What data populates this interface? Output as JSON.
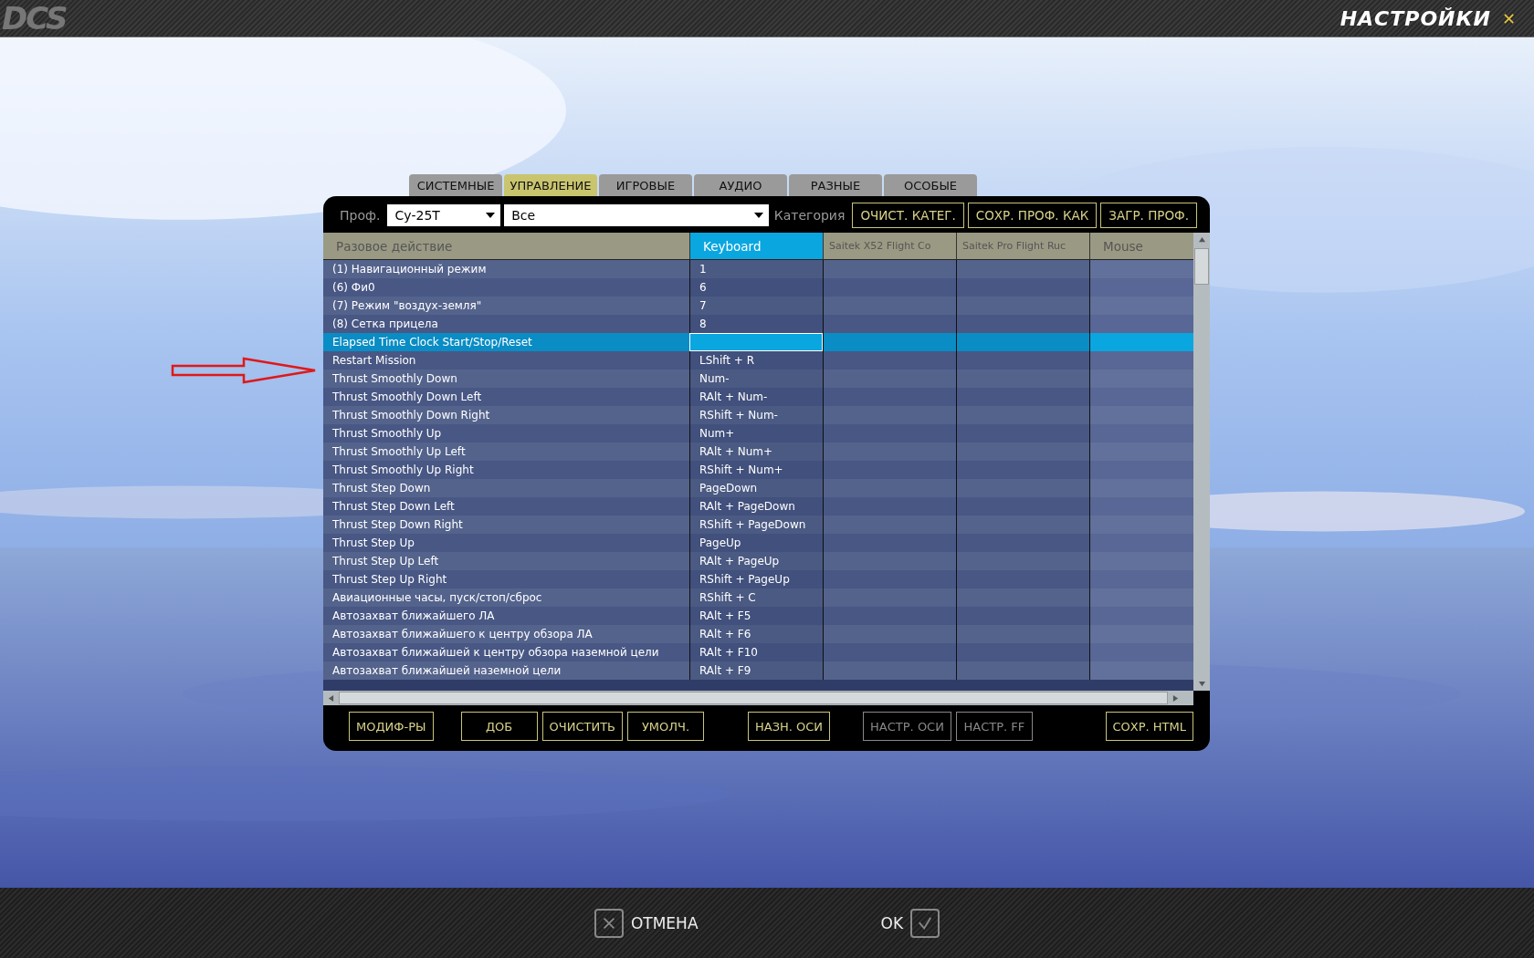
{
  "window": {
    "logo": "DCS",
    "title": "НАСТРОЙКИ",
    "close": "✕"
  },
  "tabs": [
    {
      "label": "СИСТЕМНЫЕ",
      "selected": false
    },
    {
      "label": "УПРАВЛЕНИЕ",
      "selected": true
    },
    {
      "label": "ИГРОВЫЕ",
      "selected": false
    },
    {
      "label": "АУДИО",
      "selected": false
    },
    {
      "label": "РАЗНЫЕ",
      "selected": false
    },
    {
      "label": "ОСОБЫЕ",
      "selected": false
    }
  ],
  "toolbar": {
    "profile_label": "Проф.",
    "profile": "Су-25Т",
    "filter": "Все",
    "category_label": "Категория",
    "buttons": [
      "ОЧИСТ. КАТЕГ.",
      "СОХР. ПРОФ. КАК",
      "ЗАГР. ПРОФ."
    ]
  },
  "table": {
    "columns": [
      {
        "label": "Разовое действие",
        "selected": false
      },
      {
        "label": "Keyboard",
        "selected": true
      },
      {
        "label": "Saitek X52 Flight Co",
        "selected": false
      },
      {
        "label": "Saitek Pro Flight Ruc",
        "selected": false
      },
      {
        "label": "Mouse",
        "selected": false
      }
    ],
    "rows": [
      {
        "action": "(1) Навигационный режим",
        "keyboard": "1",
        "selected": false
      },
      {
        "action": "(6) Фи0",
        "keyboard": "6",
        "selected": false
      },
      {
        "action": "(7) Режим \"воздух-земля\"",
        "keyboard": "7",
        "selected": false
      },
      {
        "action": "(8) Сетка прицела",
        "keyboard": "8",
        "selected": false
      },
      {
        "action": "Elapsed Time Clock Start/Stop/Reset",
        "selected": true
      },
      {
        "action": "Restart Mission",
        "keyboard": "LShift + R",
        "selected": false
      },
      {
        "action": "Thrust Smoothly Down",
        "keyboard": "Num-",
        "selected": false
      },
      {
        "action": "Thrust Smoothly Down Left",
        "keyboard": "RAlt + Num-",
        "selected": false
      },
      {
        "action": "Thrust Smoothly Down Right",
        "keyboard": "RShift + Num-",
        "selected": false
      },
      {
        "action": "Thrust Smoothly Up",
        "keyboard": "Num+",
        "selected": false
      },
      {
        "action": "Thrust Smoothly Up Left",
        "keyboard": "RAlt + Num+",
        "selected": false
      },
      {
        "action": "Thrust Smoothly Up Right",
        "keyboard": "RShift + Num+",
        "selected": false
      },
      {
        "action": "Thrust Step Down",
        "keyboard": "PageDown",
        "selected": false
      },
      {
        "action": "Thrust Step Down Left",
        "keyboard": "RAlt + PageDown",
        "selected": false
      },
      {
        "action": "Thrust Step Down Right",
        "keyboard": "RShift + PageDown",
        "selected": false
      },
      {
        "action": "Thrust Step Up",
        "keyboard": "PageUp",
        "selected": false
      },
      {
        "action": "Thrust Step Up Left",
        "keyboard": "RAlt + PageUp",
        "selected": false
      },
      {
        "action": "Thrust Step Up Right",
        "keyboard": "RShift + PageUp",
        "selected": false
      },
      {
        "action": "Авиационные часы, пуск/стоп/сброс",
        "keyboard": "RShift + C",
        "selected": false
      },
      {
        "action": "Автозахват ближайшего ЛА",
        "keyboard": "RAlt + F5",
        "selected": false
      },
      {
        "action": "Автозахват ближайшего к центру обзора ЛА",
        "keyboard": "RAlt + F6",
        "selected": false
      },
      {
        "action": "Автозахват ближайшей к центру обзора наземной цели",
        "keyboard": "RAlt + F10",
        "selected": false
      },
      {
        "action": "Автозахват ближайшей наземной цели",
        "keyboard": "RAlt + F9",
        "selected": false
      }
    ]
  },
  "bottom_buttons": [
    {
      "label": "МОДИФ-РЫ",
      "disabled": false
    },
    {
      "label": "ДОБ",
      "disabled": false
    },
    {
      "label": "ОЧИСТИТЬ",
      "disabled": false
    },
    {
      "label": "УМОЛЧ.",
      "disabled": false
    },
    {
      "label": "НАЗН. ОСИ",
      "disabled": false
    },
    {
      "label": "НАСТР. ОСИ",
      "disabled": true
    },
    {
      "label": "НАСТР. FF",
      "disabled": true
    },
    {
      "label": "СОХР. HTML",
      "disabled": false
    }
  ],
  "annotation": {
    "kind": "arrow"
  },
  "footer": {
    "cancel": "ОТМЕНА",
    "ok": "OK"
  }
}
